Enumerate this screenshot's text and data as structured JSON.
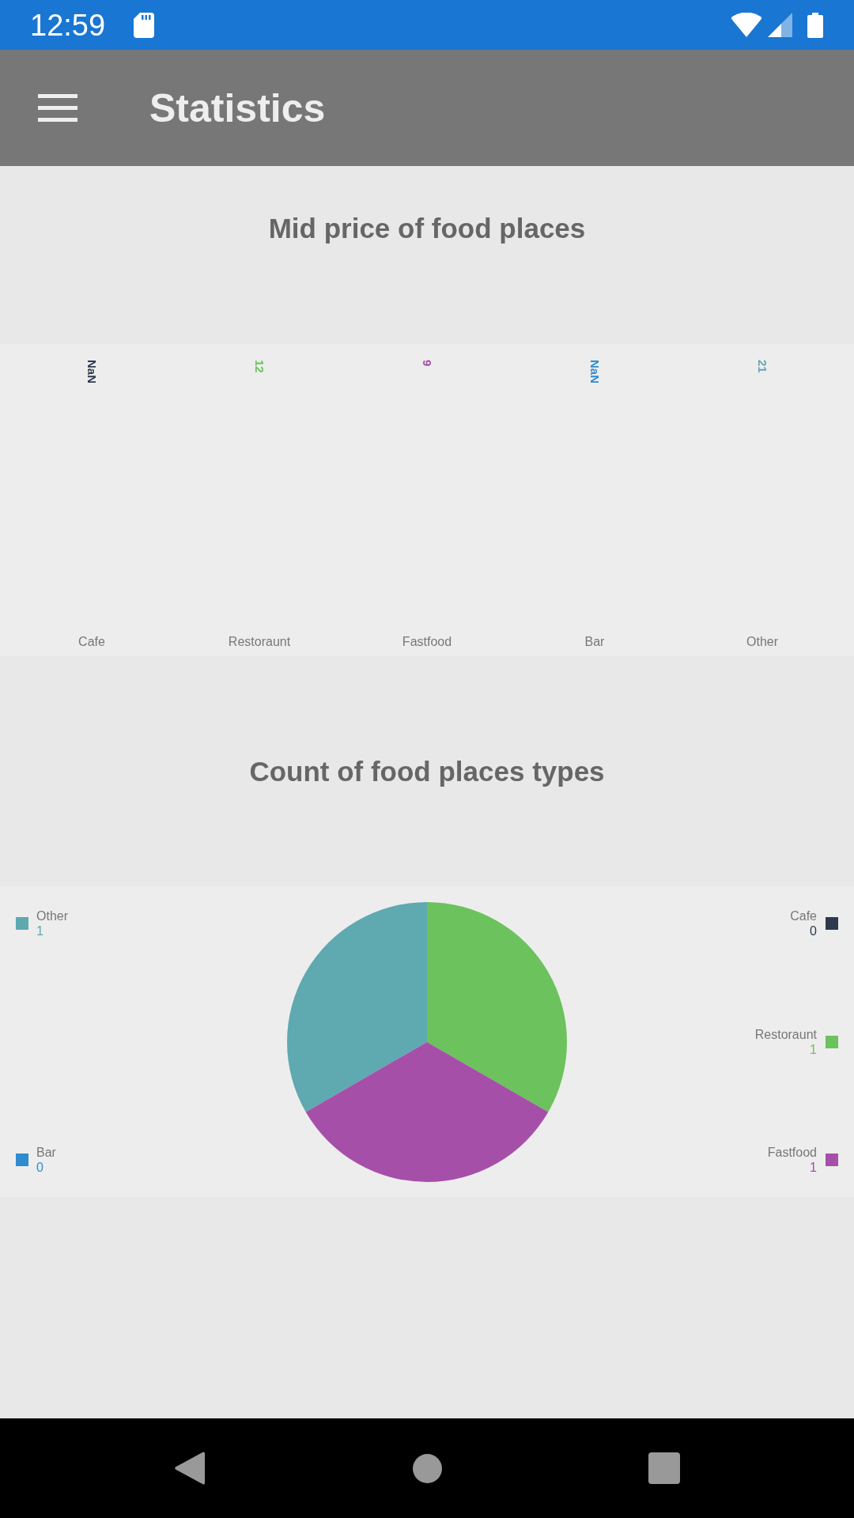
{
  "status_bar": {
    "time": "12:59"
  },
  "toolbar": {
    "title": "Statistics"
  },
  "price_chart": {
    "title": "Mid price of food places",
    "columns": [
      {
        "label": "Cafe",
        "value_label": "NaN",
        "color": "#2b3a4e"
      },
      {
        "label": "Restoraunt",
        "value_label": "12",
        "color": "#6cc25c"
      },
      {
        "label": "Fastfood",
        "value_label": "9",
        "color": "#a64fa9"
      },
      {
        "label": "Bar",
        "value_label": "NaN",
        "color": "#2e8ccf"
      },
      {
        "label": "Other",
        "value_label": "21",
        "color": "#5fa9b1"
      }
    ]
  },
  "count_chart": {
    "title": "Count of food places types",
    "chart_data": {
      "type": "pie",
      "categories": [
        "Other",
        "Cafe",
        "Restoraunt",
        "Bar",
        "Fastfood"
      ],
      "values": [
        33.33,
        0,
        33.33,
        0,
        33.34
      ]
    },
    "legend": [
      {
        "value": "1",
        "color": "#5fa9b1"
      },
      {
        "value": "0",
        "color": "#2b3a4e"
      },
      {
        "value": "1",
        "color": "#6cc25c"
      },
      {
        "value": "0",
        "color": "#2e8ccf"
      },
      {
        "value": "1",
        "color": "#a64fa9"
      }
    ]
  }
}
